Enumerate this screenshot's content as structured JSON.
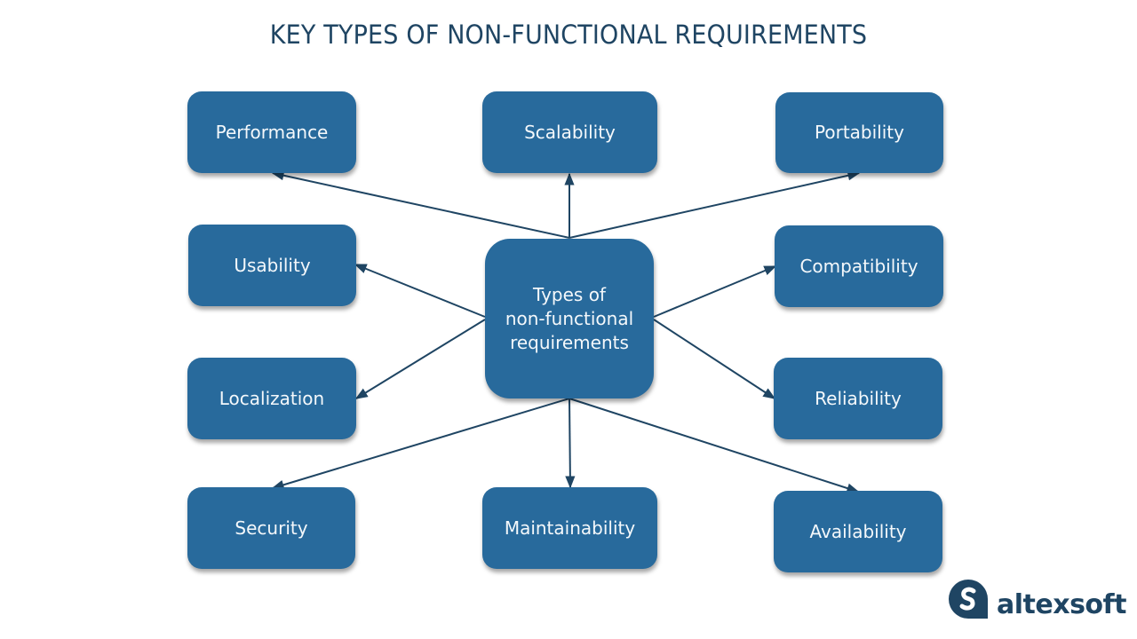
{
  "title": "KEY TYPES OF NON-FUNCTIONAL REQUIREMENTS",
  "center": {
    "label": "Types of non-functional requirements",
    "lines": [
      "Types of",
      "non-functional",
      "requirements"
    ]
  },
  "nodes": [
    {
      "id": "performance",
      "label": "Performance"
    },
    {
      "id": "scalability",
      "label": "Scalability"
    },
    {
      "id": "portability",
      "label": "Portability"
    },
    {
      "id": "usability",
      "label": "Usability"
    },
    {
      "id": "compatibility",
      "label": "Compatibility"
    },
    {
      "id": "localization",
      "label": "Localization"
    },
    {
      "id": "reliability",
      "label": "Reliability"
    },
    {
      "id": "security",
      "label": "Security"
    },
    {
      "id": "maintainability",
      "label": "Maintainability"
    },
    {
      "id": "availability",
      "label": "Availability"
    }
  ],
  "edges": [
    {
      "from": "center",
      "to": "performance"
    },
    {
      "from": "center",
      "to": "scalability"
    },
    {
      "from": "center",
      "to": "portability"
    },
    {
      "from": "center",
      "to": "usability"
    },
    {
      "from": "center",
      "to": "compatibility"
    },
    {
      "from": "center",
      "to": "localization"
    },
    {
      "from": "center",
      "to": "reliability"
    },
    {
      "from": "center",
      "to": "security"
    },
    {
      "from": "center",
      "to": "maintainability"
    },
    {
      "from": "center",
      "to": "availability"
    }
  ],
  "colors": {
    "node": "#286a9c",
    "edge": "#1f4563",
    "title": "#1f4563",
    "node_text": "#f4f8fb"
  },
  "logo": {
    "text": "altexsoft",
    "icon": "altexsoft-logo-icon"
  }
}
